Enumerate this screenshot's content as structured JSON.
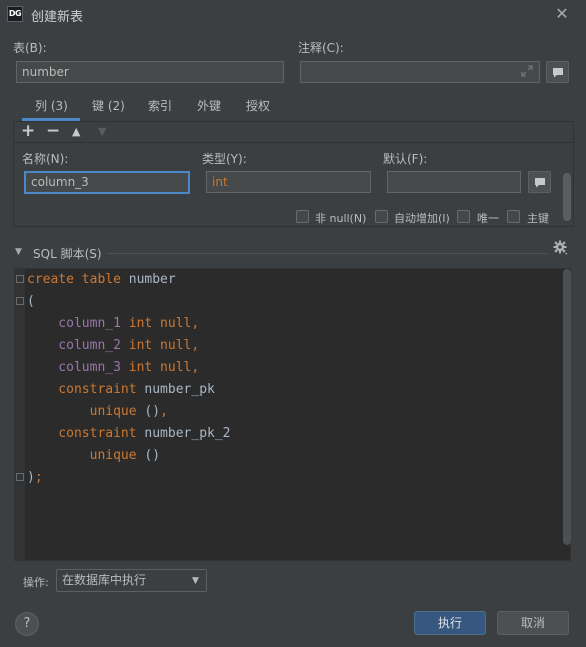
{
  "window": {
    "app_icon_text": "DG",
    "title": "创建新表",
    "close_glyph": "✕"
  },
  "form": {
    "table_label": "表(B):",
    "table_value": "number",
    "comment_label": "注释(C):",
    "comment_value": ""
  },
  "tabs": [
    {
      "label": "列 (3)",
      "active": true
    },
    {
      "label": "键 (2)",
      "active": false
    },
    {
      "label": "索引",
      "active": false
    },
    {
      "label": "外键",
      "active": false
    },
    {
      "label": "授权",
      "active": false
    }
  ],
  "toolbar": {
    "add": "+",
    "remove": "−",
    "move_up": "▲",
    "move_down": "▼"
  },
  "column_editor": {
    "name_label": "名称(N):",
    "name_value": "column_3",
    "type_label": "类型(Y):",
    "type_value": "int",
    "default_label": "默认(F):",
    "default_value": "",
    "not_null_label": "非 null(N)",
    "auto_increment_label": "自动增加(I)",
    "unique_label": "唯一",
    "primary_key_label": "主键"
  },
  "sql": {
    "section_label": "SQL 脚本(S)",
    "lines": [
      [
        {
          "t": "create table ",
          "c": "kw"
        },
        {
          "t": "number",
          "c": "id"
        }
      ],
      [
        {
          "t": "(",
          "c": "id"
        }
      ],
      [
        {
          "t": "    column_1",
          "c": "col"
        },
        {
          "t": " int null",
          "c": "kw"
        },
        {
          "t": ",",
          "c": "kw"
        }
      ],
      [
        {
          "t": "    column_2",
          "c": "col"
        },
        {
          "t": " int null",
          "c": "kw"
        },
        {
          "t": ",",
          "c": "kw"
        }
      ],
      [
        {
          "t": "    column_3",
          "c": "col"
        },
        {
          "t": " int null",
          "c": "kw"
        },
        {
          "t": ",",
          "c": "kw"
        }
      ],
      [
        {
          "t": "    constraint ",
          "c": "kw"
        },
        {
          "t": "number_pk",
          "c": "id"
        }
      ],
      [
        {
          "t": "        unique ",
          "c": "kw"
        },
        {
          "t": "()",
          "c": "id"
        },
        {
          "t": ",",
          "c": "kw"
        }
      ],
      [
        {
          "t": "    constraint ",
          "c": "kw"
        },
        {
          "t": "number_pk_2",
          "c": "id"
        }
      ],
      [
        {
          "t": "        unique ",
          "c": "kw"
        },
        {
          "t": "()",
          "c": "id"
        }
      ],
      [
        {
          "t": ")",
          "c": "id"
        },
        {
          "t": ";",
          "c": "kw"
        }
      ]
    ]
  },
  "footer": {
    "operation_label": "操作:",
    "operation_value": "在数据库中执行",
    "execute_label": "执行",
    "cancel_label": "取消",
    "help_label": "?"
  },
  "colors": {
    "accent": "#4a88c7",
    "execute_button": "#365880",
    "keyword": "#cc7832",
    "column_identifier": "#9876aa",
    "type_text": "#cc7832"
  }
}
